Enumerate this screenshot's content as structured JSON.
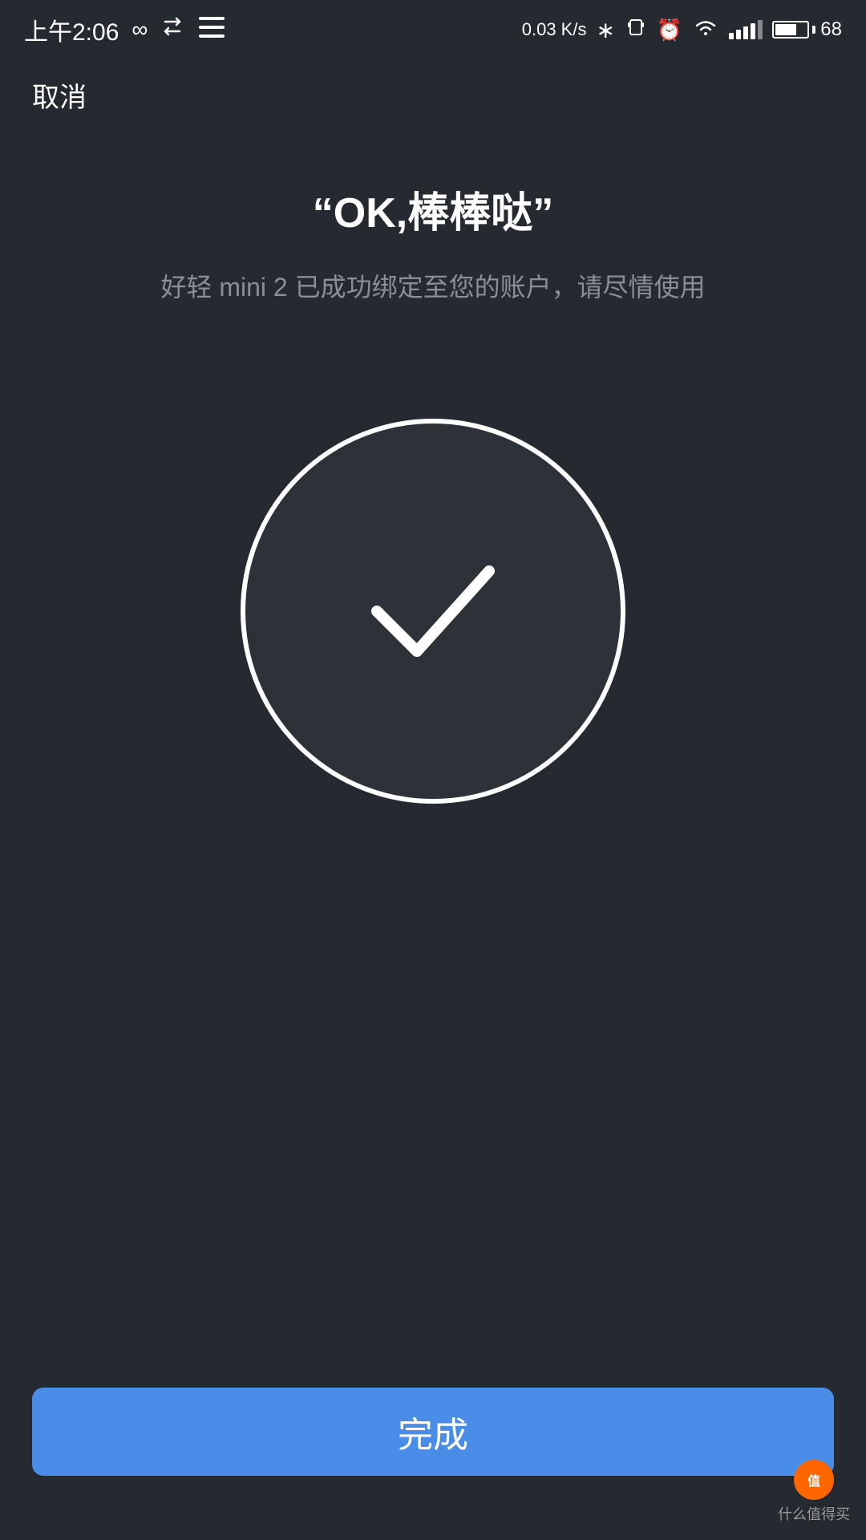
{
  "statusBar": {
    "time": "上午2:06",
    "speed": "0.03 K/s",
    "battery": "68",
    "batteryPercent": 68
  },
  "nav": {
    "cancelLabel": "取消"
  },
  "main": {
    "title": "“OK,棒棒哒”",
    "subtitle": "好轻 mini 2 已成功绑定至您的账户，请尽情使用"
  },
  "footer": {
    "doneLabel": "完成"
  },
  "watermark": {
    "line1": "值",
    "line2": "什么值得买"
  }
}
